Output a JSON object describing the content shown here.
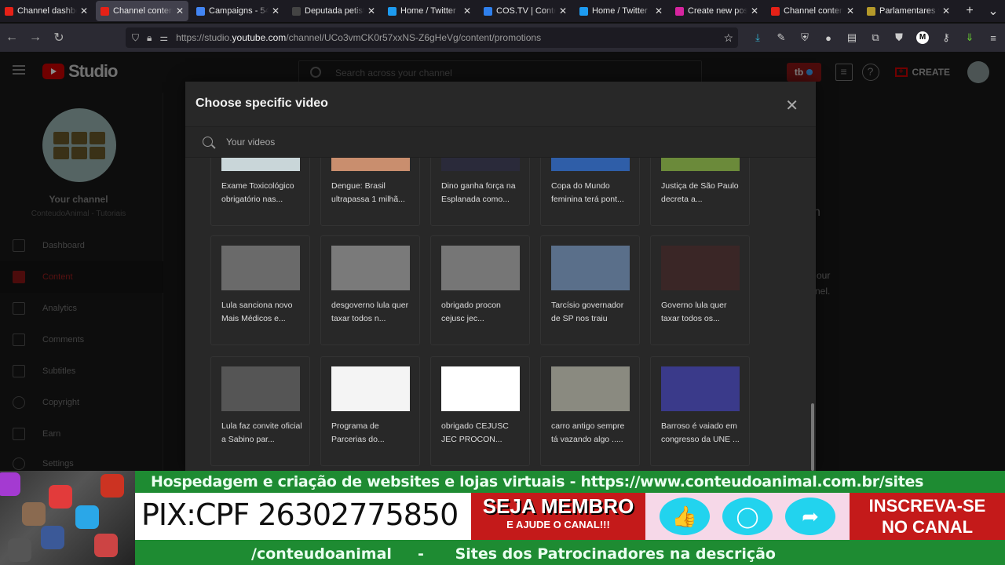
{
  "browser": {
    "tabs": [
      {
        "label": "Channel dashboard",
        "icon": "youtube-icon",
        "color": "#e62117",
        "active": false
      },
      {
        "label": "Channel content",
        "icon": "youtube-icon",
        "color": "#e62117",
        "active": true
      },
      {
        "label": "Campaigns - 54",
        "icon": "google-ads-icon",
        "color": "#4285f4",
        "active": false
      },
      {
        "label": "Deputada petista",
        "icon": "page-icon",
        "color": "#444444",
        "active": false
      },
      {
        "label": "Home / Twitter",
        "icon": "twitter-icon",
        "color": "#1d9bf0",
        "active": false
      },
      {
        "label": "COS.TV | Content",
        "icon": "costv-icon",
        "color": "#2f80ed",
        "active": false
      },
      {
        "label": "Home / Twitter",
        "icon": "twitter-icon",
        "color": "#1d9bf0",
        "active": false
      },
      {
        "label": "Create new post",
        "icon": "instagram-icon",
        "color": "#d6249f",
        "active": false
      },
      {
        "label": "Channel content",
        "icon": "youtube-icon",
        "color": "#e62117",
        "active": false
      },
      {
        "label": "Parlamentares vi",
        "icon": "page-icon",
        "color": "#b59a2a",
        "active": false
      }
    ],
    "new_tab": "+",
    "tab_list": "⌄",
    "url_prefix": "https://studio.",
    "url_domain": "youtube.com",
    "url_path": "/channel/UCo3vmCK0r57xxNS-Z6gHeVg/content/promotions"
  },
  "studio": {
    "logo_text": "Studio",
    "search_placeholder": "Search across your channel",
    "tb_label": "tb",
    "create_label": "CREATE",
    "channel": {
      "label": "Your channel",
      "name": "ConteudoAnimal - Tutoriais"
    },
    "nav": [
      {
        "label": "Dashboard",
        "icon": "dashboard-icon",
        "active": false
      },
      {
        "label": "Content",
        "icon": "content-icon",
        "active": true
      },
      {
        "label": "Analytics",
        "icon": "analytics-icon",
        "active": false
      },
      {
        "label": "Comments",
        "icon": "comments-icon",
        "active": false
      },
      {
        "label": "Subtitles",
        "icon": "subtitles-icon",
        "active": false
      },
      {
        "label": "Copyright",
        "icon": "copyright-icon",
        "active": false
      },
      {
        "label": "Earn",
        "icon": "earn-icon",
        "active": false
      },
      {
        "label": "Settings",
        "icon": "settings-icon",
        "active": false
      }
    ],
    "bg_fragments": [
      "n",
      "our",
      "nel."
    ]
  },
  "modal": {
    "title": "Choose specific video",
    "search_placeholder": "Your videos",
    "videos": [
      {
        "title": "Exame Toxicológico obrigatório nas...",
        "thumb": "#c9d6d9"
      },
      {
        "title": "Dengue: Brasil ultrapassa 1 milhã...",
        "thumb": "#c98e6e"
      },
      {
        "title": "Dino ganha força na Esplanada como...",
        "thumb": "#2a2a3a"
      },
      {
        "title": "Copa do Mundo feminina terá pont...",
        "thumb": "#2f5ea8"
      },
      {
        "title": "Justiça de São Paulo decreta a...",
        "thumb": "#6b8a3a"
      },
      {
        "title": "Lula sanciona novo Mais Médicos e...",
        "thumb": "#6a6a6a"
      },
      {
        "title": "desgoverno lula quer taxar todos n...",
        "thumb": "#7a7a7a"
      },
      {
        "title": "obrigado procon cejusc jec...",
        "thumb": "#767676"
      },
      {
        "title": "Tarcísio governador de SP nos traiu",
        "thumb": "#5a6f8a"
      },
      {
        "title": "Governo lula quer taxar todos os...",
        "thumb": "#3a2626"
      },
      {
        "title": "Lula faz convite oficial a Sabino par...",
        "thumb": "#555555"
      },
      {
        "title": "Programa de Parcerias do...",
        "thumb": "#f4f4f4"
      },
      {
        "title": "obrigado CEJUSC JEC PROCON...",
        "thumb": "#ffffff"
      },
      {
        "title": "carro antigo sempre tá vazando algo .....",
        "thumb": "#8a8a80"
      },
      {
        "title": "Barroso é vaiado em congresso da UNE ...",
        "thumb": "#3a3a8a"
      }
    ]
  },
  "banner": {
    "top_text": "Hospedagem e criação de websites e lojas virtuais - https://www.conteudoanimal.com.br/sites",
    "pix": "PIX:CPF 26302775850",
    "membro_line1": "SEJA MEMBRO",
    "membro_line2": "E AJUDE O CANAL!!!",
    "inscreva_line1": "INSCREVA-SE",
    "inscreva_line2": "NO CANAL",
    "bottom_text": "/conteudoanimal     -      Sites dos Patrocinadores na descrição",
    "like_icon": "👍",
    "comment_icon": "◯",
    "share_icon": "➦"
  }
}
